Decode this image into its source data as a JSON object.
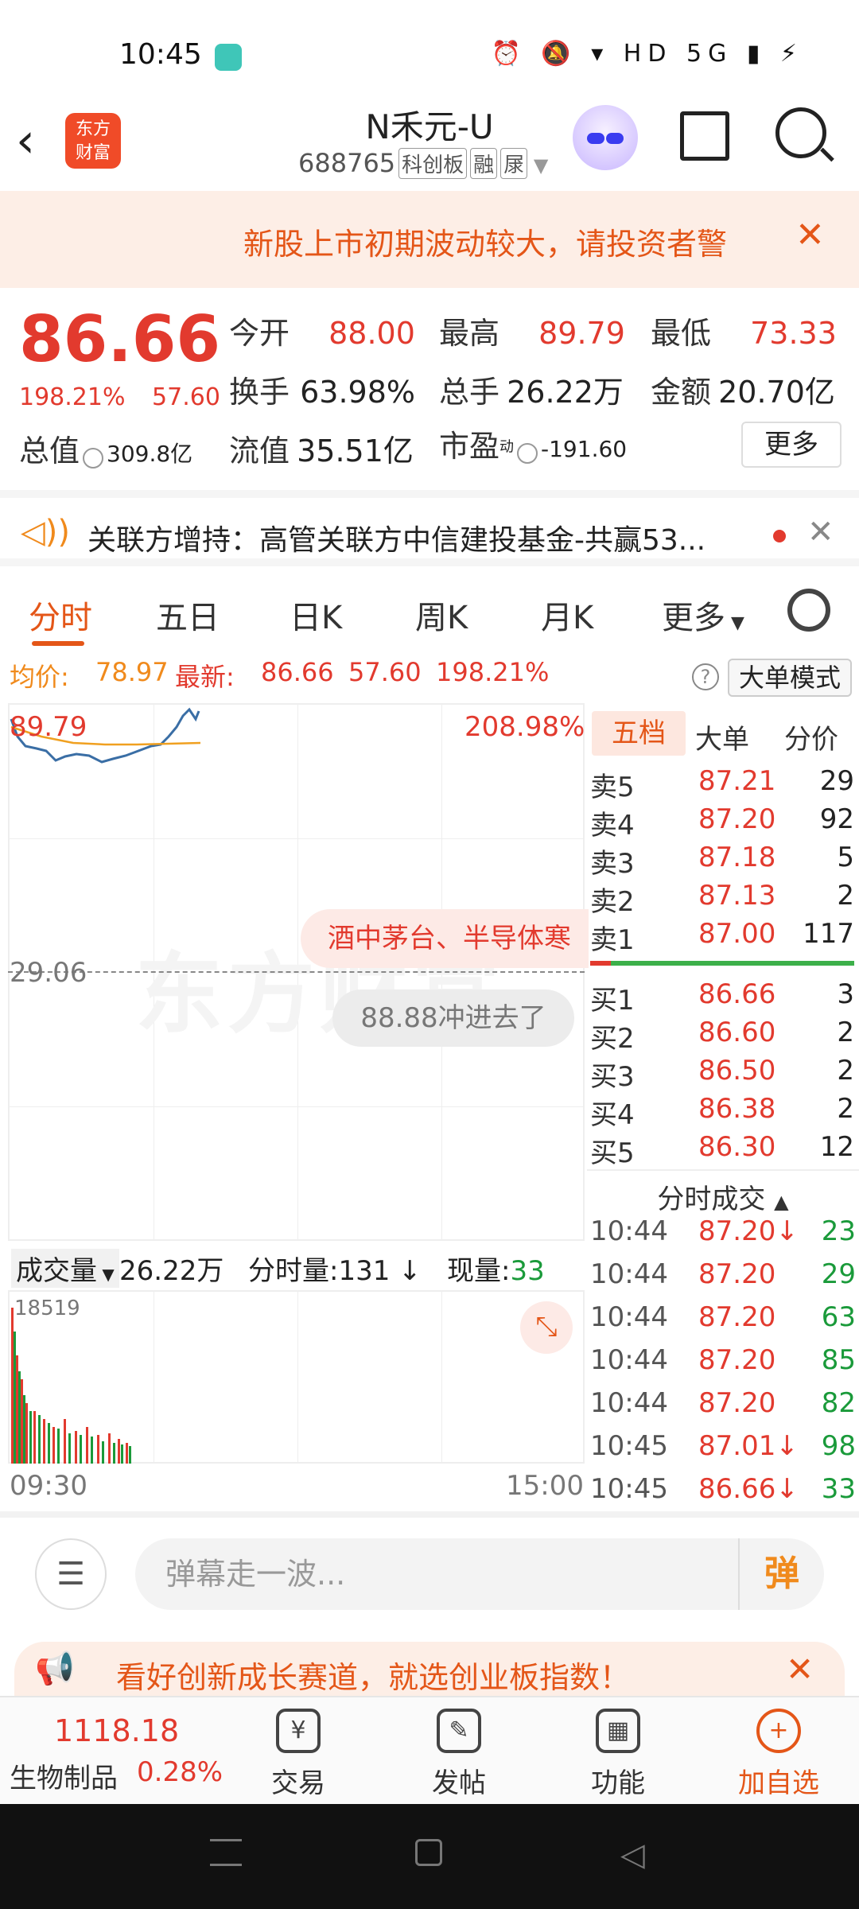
{
  "status_bar": {
    "time": "10:45",
    "icons": "⏰ 🔕 ▾ HD 5G ▮ ⚡"
  },
  "header": {
    "title": "N禾元-U",
    "code": "688765",
    "tags": [
      "科创板",
      "融",
      "㞗"
    ],
    "logo_text": [
      "东方",
      "财富"
    ]
  },
  "notice": {
    "text": "新股上市初期波动较大，请投资者警"
  },
  "quote": {
    "price": "86.66",
    "change_pct": "198.21%",
    "change": "57.60",
    "open_label": "今开",
    "open": "88.00",
    "high_label": "最高",
    "high": "89.79",
    "low_label": "最低",
    "low": "73.33",
    "turnover_label": "换手",
    "turnover": "63.98%",
    "volume_label": "总手",
    "volume": "26.22万",
    "amount_label": "金额",
    "amount": "20.70亿",
    "mktcap_label": "总值",
    "mktcap": "309.8亿",
    "float_label": "流值",
    "float": "35.51亿",
    "pe_label": "市盈",
    "pe_sup": "动",
    "pe": "-191.60",
    "more_label": "更多"
  },
  "news_ticker": {
    "text": "关联方增持：高管关联方中信建投基金-共赢53..."
  },
  "tabs": [
    "分时",
    "五日",
    "日K",
    "周K",
    "月K",
    "更多"
  ],
  "stats_line": {
    "avg_label": "均价:",
    "avg": "78.97",
    "last_label": "最新:",
    "last": "86.66",
    "change": "57.60",
    "change_pct": "198.21%",
    "mode_button": "大单模式",
    "help": "?"
  },
  "chart": {
    "high_label": "89.79",
    "high_pct": "208.98%",
    "mid_label": "29.06",
    "watermark": "东方财富",
    "news_bubble": "酒中茅台、半导体寒",
    "chat_bubble": "88.88冲进去了"
  },
  "volume_bar": {
    "selector": "成交量",
    "total": "26.22万",
    "per_min": "分时量:131",
    "now_label": "现量:",
    "now": "33",
    "max": "18519",
    "time_start": "09:30",
    "time_end": "15:00"
  },
  "order_book": {
    "tabs": [
      "五档",
      "大单",
      "分价"
    ],
    "asks": [
      {
        "label": "卖5",
        "price": "87.21",
        "vol": "29"
      },
      {
        "label": "卖4",
        "price": "87.20",
        "vol": "92"
      },
      {
        "label": "卖3",
        "price": "87.18",
        "vol": "5"
      },
      {
        "label": "卖2",
        "price": "87.13",
        "vol": "2"
      },
      {
        "label": "卖1",
        "price": "87.00",
        "vol": "117"
      }
    ],
    "bids": [
      {
        "label": "买1",
        "price": "86.66",
        "vol": "3"
      },
      {
        "label": "买2",
        "price": "86.60",
        "vol": "2"
      },
      {
        "label": "买3",
        "price": "86.50",
        "vol": "2"
      },
      {
        "label": "买4",
        "price": "86.38",
        "vol": "2"
      },
      {
        "label": "买5",
        "price": "86.30",
        "vol": "12"
      }
    ],
    "trades_title": "分时成交",
    "trades": [
      {
        "time": "10:44",
        "price": "87.20↓",
        "vol": "23"
      },
      {
        "time": "10:44",
        "price": "87.20",
        "vol": "29"
      },
      {
        "time": "10:44",
        "price": "87.20",
        "vol": "63"
      },
      {
        "time": "10:44",
        "price": "87.20",
        "vol": "85"
      },
      {
        "time": "10:44",
        "price": "87.20",
        "vol": "82"
      },
      {
        "time": "10:45",
        "price": "87.01↓",
        "vol": "98"
      },
      {
        "time": "10:45",
        "price": "86.66↓",
        "vol": "33"
      }
    ]
  },
  "comment_bar": {
    "placeholder": "弹幕走一波...",
    "send": "弹"
  },
  "ad": {
    "text": "看好创新成长赛道，就选创业板指数！"
  },
  "bottom_nav": {
    "index_value": "1118.18",
    "sector": "生物制品",
    "sector_pct": "0.28%",
    "items": [
      "交易",
      "发帖",
      "功能",
      "加自选"
    ]
  },
  "colors": {
    "up": "#e23a2e",
    "down": "#1a9a3a",
    "accent": "#e45618",
    "avg_line": "#f0a020",
    "price_line": "#3a6ea5"
  }
}
